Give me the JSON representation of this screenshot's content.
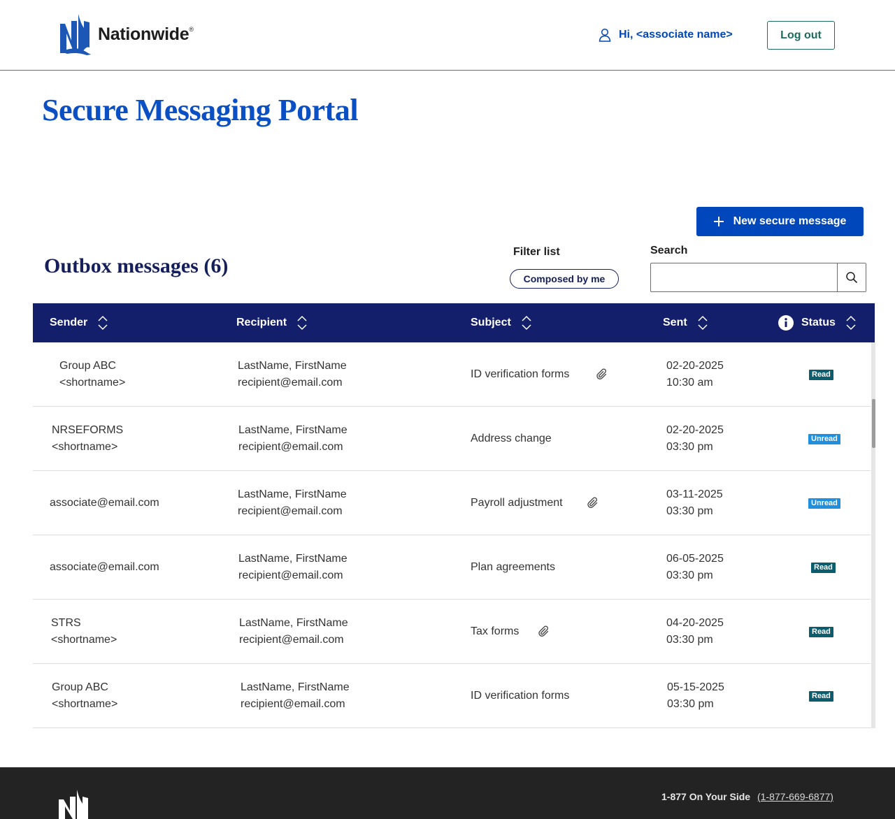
{
  "header": {
    "logo_text": "Nationwide",
    "logo_mark": "®",
    "greeting": "Hi, <associate name>",
    "logout_label": "Log out"
  },
  "page": {
    "title": "Secure Messaging Portal",
    "new_message_label": "New secure message",
    "section_title": "Outbox messages (6)",
    "filter_label": "Filter list",
    "filter_chip": "Composed by me",
    "search_label": "Search",
    "search_placeholder": "",
    "search_value": ""
  },
  "table": {
    "columns": [
      "Sender",
      "Recipient",
      "Subject",
      "Sent",
      "Status"
    ],
    "rows": [
      {
        "sender": [
          "Group ABC",
          "<shortname>"
        ],
        "recipient": [
          "LastName, FirstName",
          "recipient@email.com"
        ],
        "subject": "ID verification forms",
        "attachment": true,
        "sent": [
          "02-20-2025",
          "10:30 am"
        ],
        "status": "Read"
      },
      {
        "sender": [
          "NRSEFORMS",
          "<shortname>"
        ],
        "recipient": [
          "LastName, FirstName",
          "recipient@email.com"
        ],
        "subject": "Address change",
        "attachment": false,
        "sent": [
          "02-20-2025",
          "03:30 pm"
        ],
        "status": "Unread"
      },
      {
        "sender": [
          "associate@email.com"
        ],
        "recipient": [
          "LastName, FirstName",
          "recipient@email.com"
        ],
        "subject": "Payroll adjustment",
        "attachment": true,
        "sent": [
          "03-11-2025",
          "03:30 pm"
        ],
        "status": "Unread"
      },
      {
        "sender": [
          "associate@email.com"
        ],
        "recipient": [
          "LastName, FirstName",
          "recipient@email.com"
        ],
        "subject": "Plan agreements",
        "attachment": false,
        "sent": [
          "06-05-2025",
          "03:30 pm"
        ],
        "status": "Read"
      },
      {
        "sender": [
          "STRS",
          "<shortname>"
        ],
        "recipient": [
          "LastName, FirstName",
          "recipient@email.com"
        ],
        "subject": "Tax forms",
        "attachment": true,
        "sent": [
          "04-20-2025",
          "03:30 pm"
        ],
        "status": "Read"
      },
      {
        "sender": [
          "Group ABC",
          "<shortname>"
        ],
        "recipient": [
          "LastName, FirstName",
          "recipient@email.com"
        ],
        "subject": "ID verification forms",
        "attachment": false,
        "sent": [
          "05-15-2025",
          "03:30 pm"
        ],
        "status": "Read"
      }
    ]
  },
  "footer": {
    "phone_label": "1-877 On Your Side",
    "phone_number": "(1-877-669-6877)"
  },
  "colors": {
    "brand_blue": "#0047bb",
    "navy": "#141f6b",
    "green": "#1b6d5d",
    "read_badge": "#0b5d6e",
    "unread_badge": "#1f8fde",
    "footer_bg": "#232323"
  },
  "icons": {
    "user": "user-icon",
    "plus": "plus-icon",
    "search": "search-icon",
    "sort": "sort-icon",
    "info": "info-icon",
    "attachment": "paperclip-icon"
  }
}
